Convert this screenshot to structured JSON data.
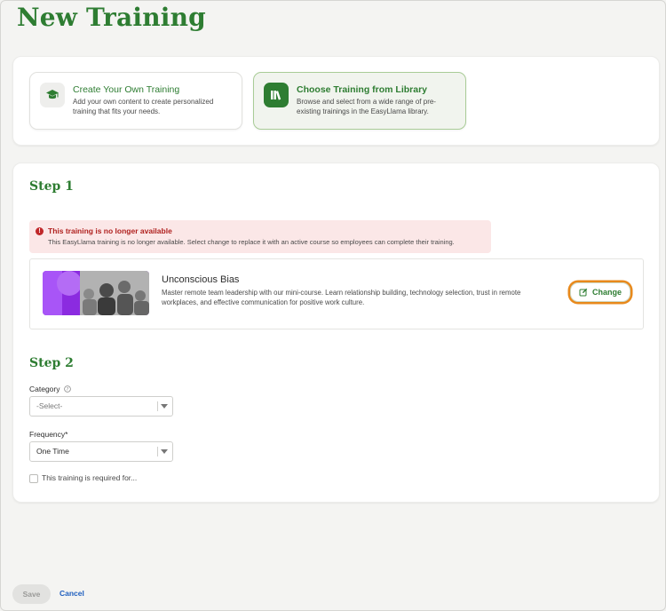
{
  "page": {
    "title": "New Training"
  },
  "options": [
    {
      "title": "Create Your Own Training",
      "desc": "Add your own content to create personalized training that fits your needs.",
      "icon": "graduation-cap-icon"
    },
    {
      "title": "Choose Training from Library",
      "desc": "Browse and select from a wide range of pre-existing trainings in the EasyLlama library.",
      "icon": "library-books-icon"
    }
  ],
  "step1": {
    "heading": "Step 1",
    "alert": {
      "title": "This training is no longer available",
      "text": "This EasyLlama training is no longer available. Select change to replace it with an active course so employees can complete their training."
    },
    "course": {
      "title": "Unconscious Bias",
      "desc": "Master remote team leadership with our mini-course. Learn relationship building, technology selection, trust in remote workplaces, and effective communication for positive work culture.",
      "change_label": "Change"
    }
  },
  "step2": {
    "heading": "Step 2",
    "category_label": "Category",
    "category_value": "-Select-",
    "frequency_label": "Frequency*",
    "frequency_value": "One Time",
    "required_label": "This training is required for..."
  },
  "footer": {
    "save_label": "Save",
    "cancel_label": "Cancel"
  },
  "colors": {
    "brand_green": "#2e7d32",
    "alert_red": "#c0282a",
    "focus_orange": "#e8891c",
    "link_blue": "#1f5fbf"
  }
}
